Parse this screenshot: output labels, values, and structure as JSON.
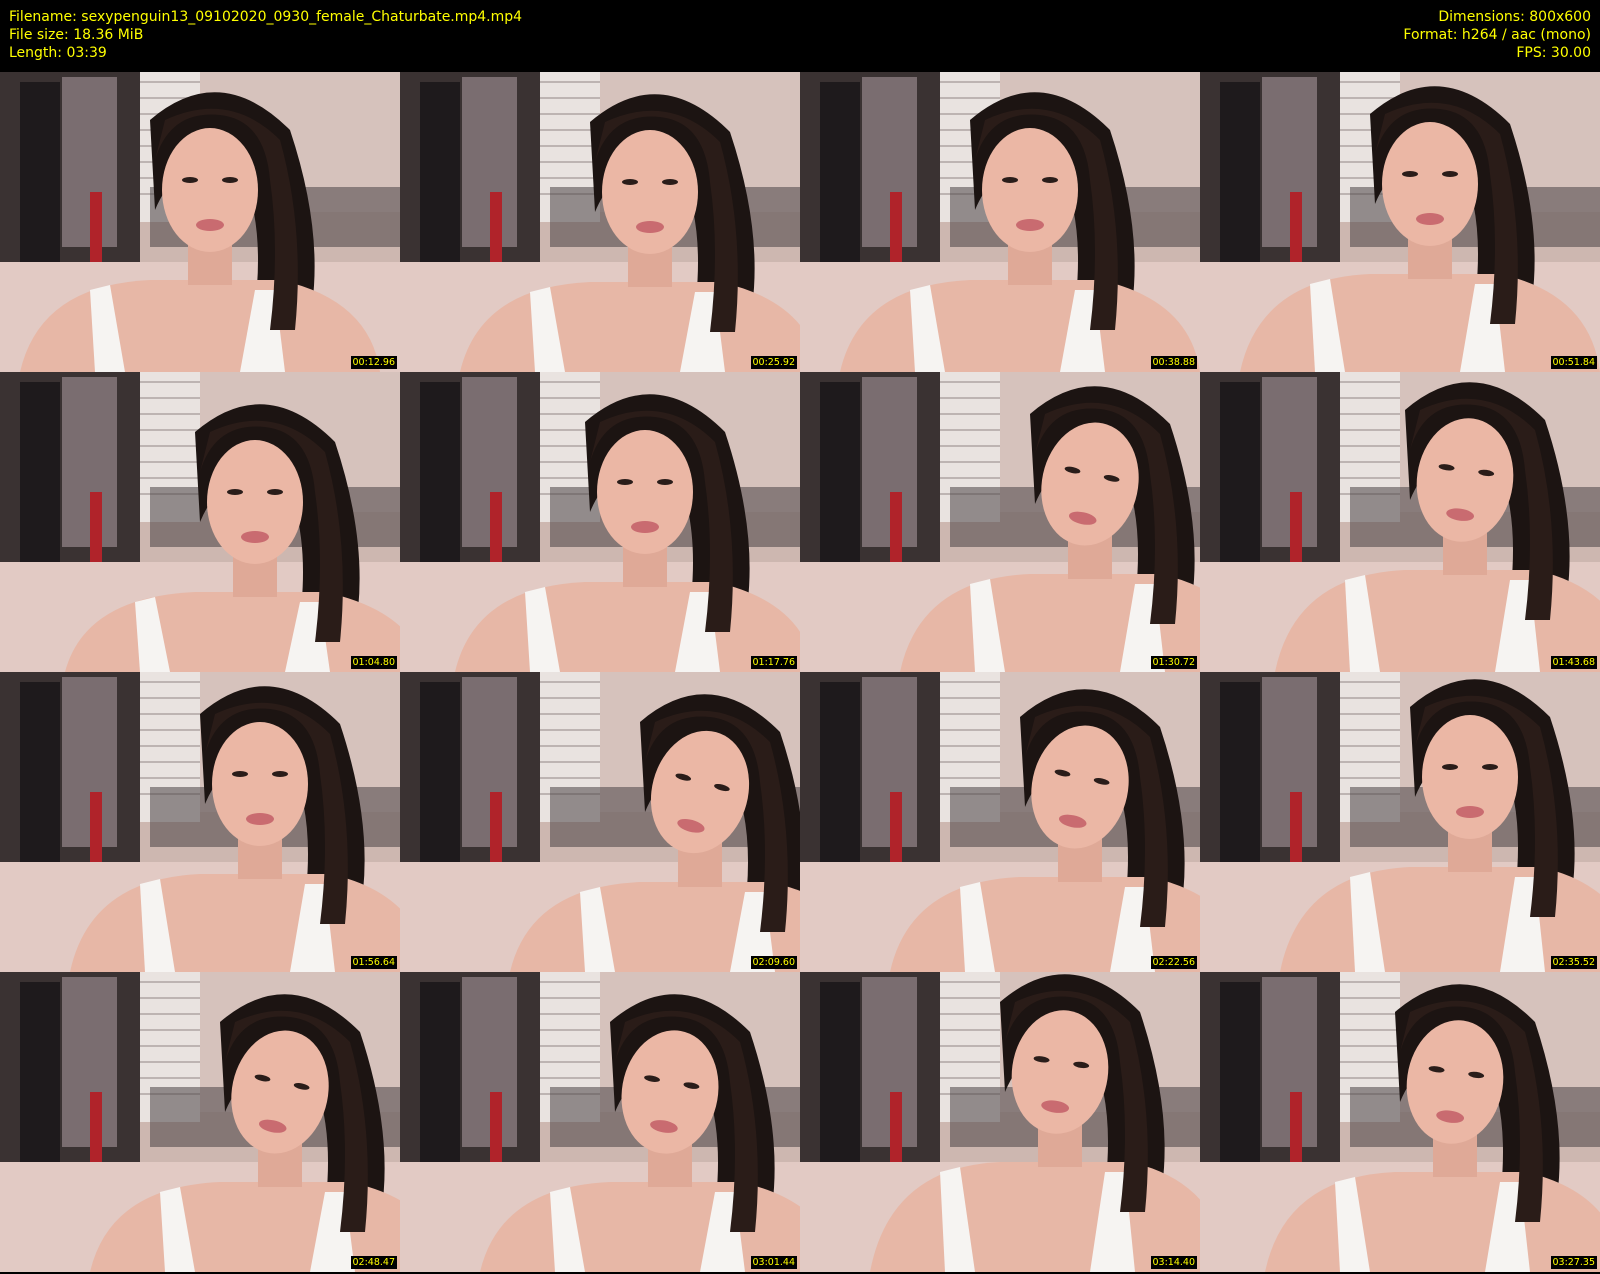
{
  "header": {
    "filename_line": "Filename: sexypenguin13_09102020_0930_female_Chaturbate.mp4.mp4",
    "filesize_line": "File size: 18.36 MiB",
    "length_line": "Length: 03:39",
    "dimensions_line": "Dimensions: 800x600",
    "format_line": "Format: h264 / aac (mono)",
    "fps_line": "FPS: 30.00"
  },
  "colors": {
    "background": "#000000",
    "text": "#ffff00"
  },
  "thumbnails": [
    {
      "timestamp": "00:12.96"
    },
    {
      "timestamp": "00:25.92"
    },
    {
      "timestamp": "00:38.88"
    },
    {
      "timestamp": "00:51.84"
    },
    {
      "timestamp": "01:04.80"
    },
    {
      "timestamp": "01:17.76"
    },
    {
      "timestamp": "01:30.72"
    },
    {
      "timestamp": "01:43.68"
    },
    {
      "timestamp": "01:56.64"
    },
    {
      "timestamp": "02:09.60"
    },
    {
      "timestamp": "02:22.56"
    },
    {
      "timestamp": "02:35.52"
    },
    {
      "timestamp": "02:48.47"
    },
    {
      "timestamp": "03:01.44"
    },
    {
      "timestamp": "03:14.40"
    },
    {
      "timestamp": "03:27.35"
    }
  ]
}
